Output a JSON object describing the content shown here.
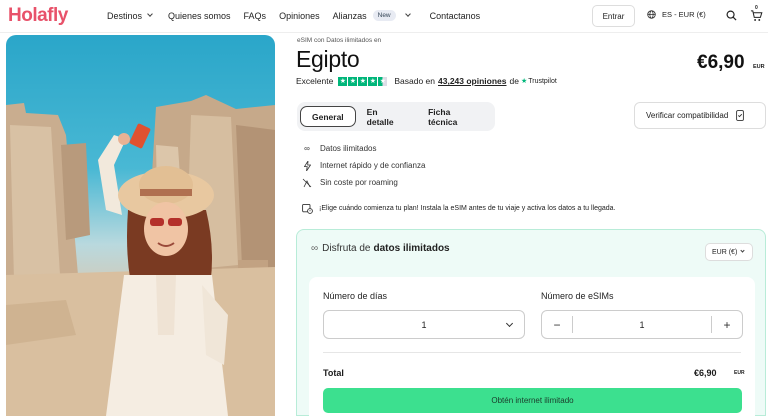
{
  "brand": {
    "name": "Holafly",
    "accent": "#e8526a"
  },
  "nav": {
    "links": [
      {
        "label": "Destinos",
        "has_dropdown": true
      },
      {
        "label": "Quienes somos",
        "has_dropdown": false
      },
      {
        "label": "FAQs",
        "has_dropdown": false
      },
      {
        "label": "Opiniones",
        "has_dropdown": false
      },
      {
        "label": "Alianzas",
        "badge": "New",
        "has_dropdown": true
      },
      {
        "label": "Contactanos",
        "has_dropdown": false
      }
    ],
    "enter_label": "Entrar",
    "lang_label": "ES - EUR (€)",
    "cart_count": "0",
    "icons": [
      "globe-icon",
      "search-icon",
      "cart-icon"
    ]
  },
  "product": {
    "kicker": "eSIM con Datos ilimitados en",
    "title": "Egipto",
    "price": "€6,90",
    "price_currency": "EUR",
    "rating": {
      "label": "Excelente",
      "stars": 4.5,
      "based_on": "Basado en",
      "count_link": "43,243 opiniones",
      "source_prefix": "de",
      "source": "Trustpilot"
    }
  },
  "tabs": [
    {
      "label": "General",
      "active": true
    },
    {
      "label": "En detalle",
      "active": false
    },
    {
      "label": "Ficha técnica",
      "active": false
    }
  ],
  "compat_label": "Verificar compatibilidad",
  "features": [
    {
      "icon": "infinity-icon",
      "label": "Datos ilimitados"
    },
    {
      "icon": "lightning-icon",
      "label": "Internet rápido y de confianza"
    },
    {
      "icon": "no-roaming-icon",
      "label": "Sin coste por roaming"
    }
  ],
  "tip": "¡Elige cuándo comienza tu plan! Instala la eSIM antes de tu viaje y activa los datos a tu llegada.",
  "plan": {
    "heading_prefix": "Disfruta de",
    "heading_bold": "datos ilimitados",
    "currency_select": "EUR (€)",
    "days_label": "Número de días",
    "days_value": "1",
    "esims_label": "Número de eSIMs",
    "esims_value": "1",
    "total_label": "Total",
    "total_value": "€6,90",
    "total_currency": "EUR",
    "cta_label": "Obtén internet ilimitado",
    "cta_color": "#3ce08f"
  }
}
